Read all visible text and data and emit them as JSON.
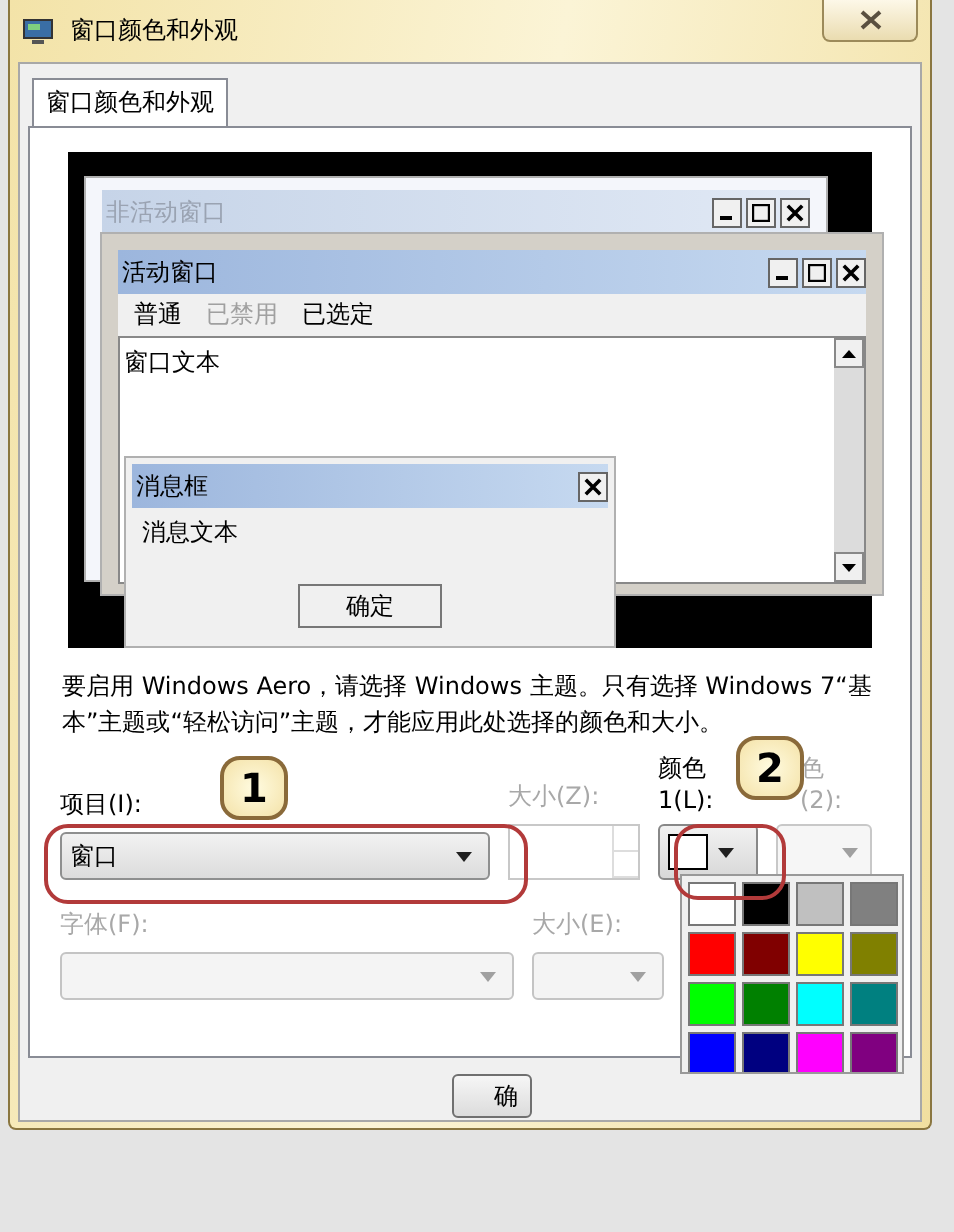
{
  "window": {
    "title": "窗口颜色和外观"
  },
  "tabs": [
    {
      "label": "窗口颜色和外观",
      "selected": true
    }
  ],
  "preview": {
    "inactive_window": {
      "title": "非活动窗口"
    },
    "active_window": {
      "title": "活动窗口",
      "menu": [
        {
          "label": "普通",
          "disabled": false
        },
        {
          "label": "已禁用",
          "disabled": true
        },
        {
          "label": "已选定",
          "disabled": false
        }
      ],
      "text": "窗口文本"
    },
    "message_box": {
      "title": "消息框",
      "text": "消息文本",
      "button": "确定"
    }
  },
  "description": "要启用 Windows Aero，请选择 Windows 主题。只有选择 Windows 7“基本”主题或“轻松访问”主题，才能应用此处选择的颜色和大小。",
  "item": {
    "label": "项目(I):",
    "value": "窗口",
    "disabled": false
  },
  "item_size": {
    "label": "大小(Z):",
    "disabled": true
  },
  "color1": {
    "label_lines": [
      "颜色",
      "1(L):"
    ],
    "color": "#ffffff"
  },
  "color2": {
    "label_lines": [
      "色",
      "(2):"
    ],
    "disabled": true
  },
  "font": {
    "label": "字体(F):",
    "disabled": true
  },
  "font_size": {
    "label": "大小(E):",
    "disabled": true
  },
  "palette": [
    {
      "color": "#ffffff"
    },
    {
      "color": "#000000"
    },
    {
      "color": "#c0c0c0"
    },
    {
      "color": "#808080"
    },
    {
      "color": "#ff0000"
    },
    {
      "color": "#800000"
    },
    {
      "color": "#ffff00"
    },
    {
      "color": "#808000"
    },
    {
      "color": "#00ff00"
    },
    {
      "color": "#008000"
    },
    {
      "color": "#00ffff"
    },
    {
      "color": "#008080"
    },
    {
      "color": "#0000ff"
    },
    {
      "color": "#000080"
    },
    {
      "color": "#ff00ff"
    },
    {
      "color": "#800080"
    }
  ],
  "callouts": [
    "1",
    "2"
  ],
  "buttons": [
    {
      "label": "确"
    }
  ]
}
